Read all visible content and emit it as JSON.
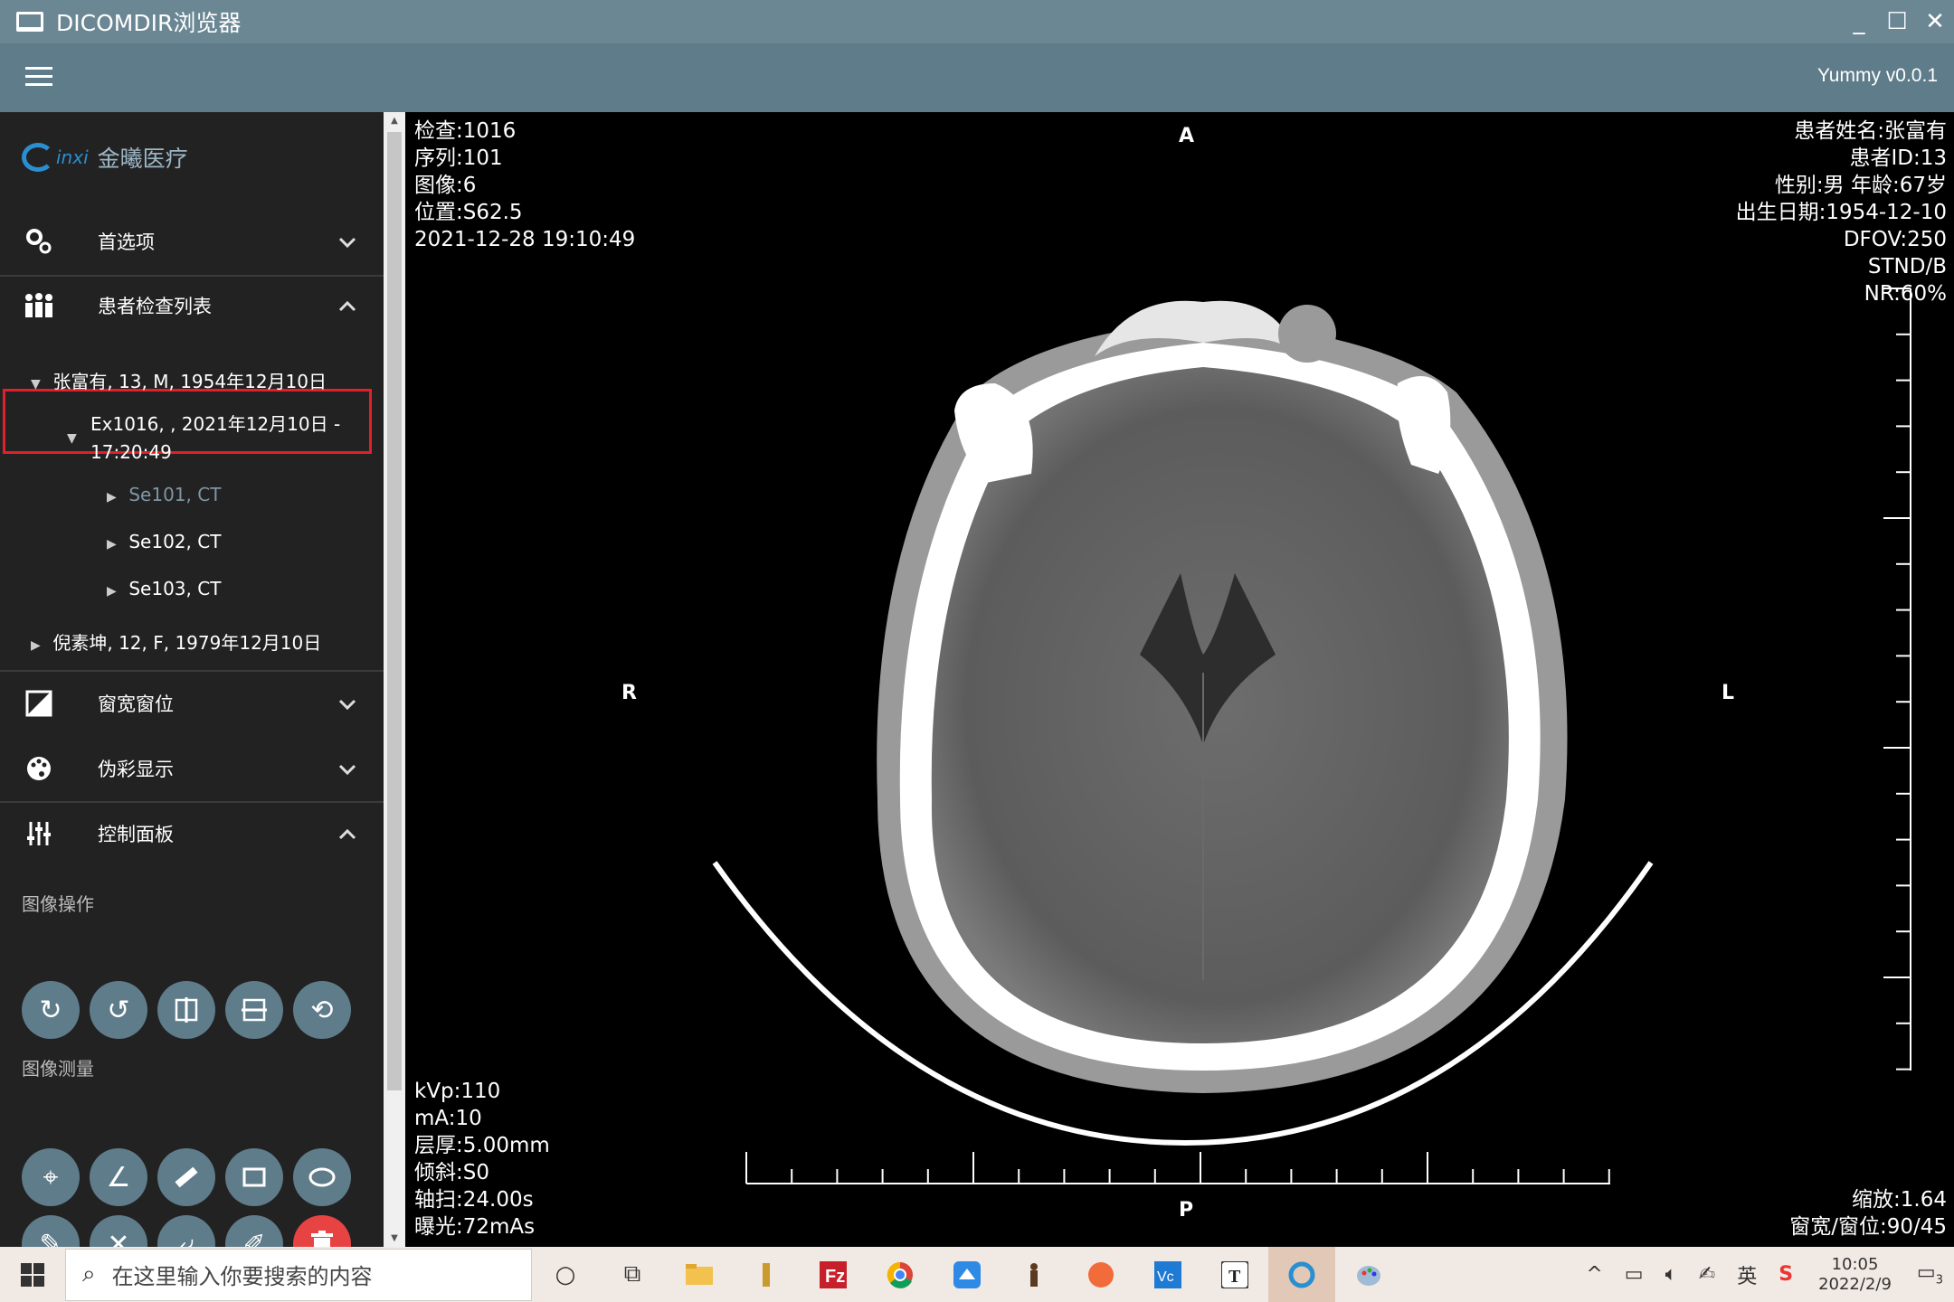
{
  "window": {
    "title": "DICOMDIR浏览器",
    "minimize": "_",
    "maximize": "☐",
    "close": "✕"
  },
  "appbar": {
    "version": "Yummy v0.0.1"
  },
  "logo": {
    "mark_text": "inxi",
    "company": "金曦医疗"
  },
  "sidebar": {
    "preferences": {
      "label": "首选项",
      "chevron": "⌄"
    },
    "patient_list": {
      "label": "患者检查列表",
      "chevron": "⌃"
    },
    "tree": {
      "patient1": "张富有, 13, M, 1954年12月10日",
      "exam_line1": "Ex1016, , 2021年12月10日 -",
      "exam_line2": "17:20:49",
      "series": [
        "Se101, CT",
        "Se102, CT",
        "Se103, CT"
      ],
      "patient2": "倪素坤, 12, F, 1979年12月10日"
    },
    "window_level": {
      "label": "窗宽窗位",
      "chevron": "⌄"
    },
    "pseudo_color": {
      "label": "伪彩显示",
      "chevron": "⌄"
    },
    "control_panel": {
      "label": "控制面板",
      "chevron": "⌃"
    },
    "image_ops_title": "图像操作",
    "image_measure_title": "图像测量"
  },
  "overlay": {
    "top_left": [
      "检查:1016",
      "序列:101",
      "图像:6",
      "位置:S62.5",
      "2021-12-28 19:10:49"
    ],
    "top_right": [
      "患者姓名:张富有",
      "患者ID:13",
      "性别:男 年龄:67岁",
      "出生日期:1954-12-10",
      "DFOV:250",
      "STND/B",
      "NR:60%"
    ],
    "bottom_left": [
      "kVp:110",
      "mA:10",
      "层厚:5.00mm",
      "倾斜:S0",
      "轴扫:24.00s",
      "曝光:72mAs"
    ],
    "bottom_right": [
      "缩放:1.64",
      "窗宽/窗位:90/45"
    ],
    "orient": {
      "top": "A",
      "bottom": "P",
      "left": "R",
      "right": "L"
    }
  },
  "taskbar": {
    "search_placeholder": "在这里输入你要搜索的内容",
    "time": "10:05",
    "date": "2022/2/9",
    "ime": "英",
    "notif_count": "3"
  }
}
